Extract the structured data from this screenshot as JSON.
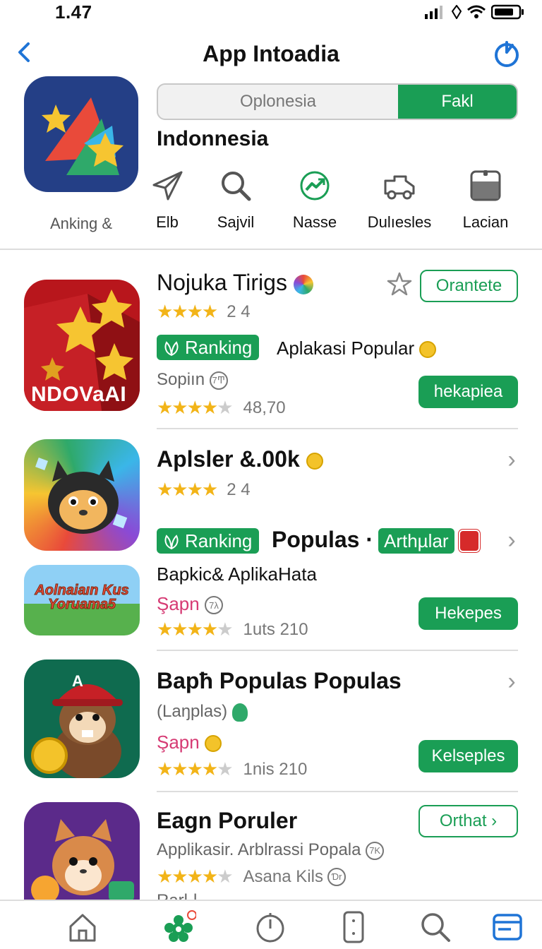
{
  "status": {
    "time": "1.47"
  },
  "nav": {
    "title": "App Intoadia"
  },
  "hero": {
    "label": "Anking &"
  },
  "segmented": {
    "options": [
      "Oplonesia",
      "Fakl"
    ],
    "active_index": 1
  },
  "country": "Indonnesia",
  "categories": [
    {
      "label": "Elb",
      "icon": "send-icon"
    },
    {
      "label": "Sajvil",
      "icon": "search-icon"
    },
    {
      "label": "Nasse",
      "icon": "trend-icon"
    },
    {
      "label": "Dulıeslеs",
      "icon": "truck-icon"
    },
    {
      "label": "Lacian",
      "icon": "calendar-icon"
    }
  ],
  "apps": [
    {
      "name": "Nojuka Tirigs",
      "rating_text": "2 4",
      "rank_badge": "Ranking",
      "rank_text": "Aplakasi Popular",
      "sub": "Sopiın",
      "sub_badge": "7Ͳ",
      "rating2_text": "48,70",
      "button_outline": "Orantete",
      "button_fill": "hekapiea",
      "icon_text": "NDOVaAI"
    },
    {
      "name": "Aplsler &.00k",
      "rating_text": "2 4",
      "rank_badge": "Ranking",
      "rank_text": "Populas ·",
      "badge2": "Arthµlar",
      "sub": "Bapkic& AplikaHata",
      "sub2": "Şapn",
      "sub2_badge": "7λ",
      "rating2_text": "1uts 210",
      "button_fill": "Hekepes",
      "banner_text": "Aolnaiaın Kus Yoruama5"
    },
    {
      "name": "Bapħ Populas Populas",
      "sub": "(Laŋplas)",
      "sub2": "Şapn",
      "rating2_text": "1nis 210",
      "button_fill": "Kelseples",
      "icon_text": "A"
    },
    {
      "name": "Eagn Poruler",
      "sub": "Applikasir. Arblrassi Popala",
      "sub_badge": "7K",
      "rating2_text": "Asana Kils",
      "rating2_badge": "Ɗr",
      "button_outline": "Orthat",
      "partial_text": "Ŗarl·l"
    }
  ],
  "tabbar": [
    "home-icon",
    "badge-flower-icon",
    "timer-icon",
    "phone-icon",
    "search-icon",
    "card-icon"
  ],
  "colors": {
    "accent": "#1a9e55",
    "star": "#f2b418",
    "blue": "#1f74d6",
    "pink": "#d63b74"
  }
}
